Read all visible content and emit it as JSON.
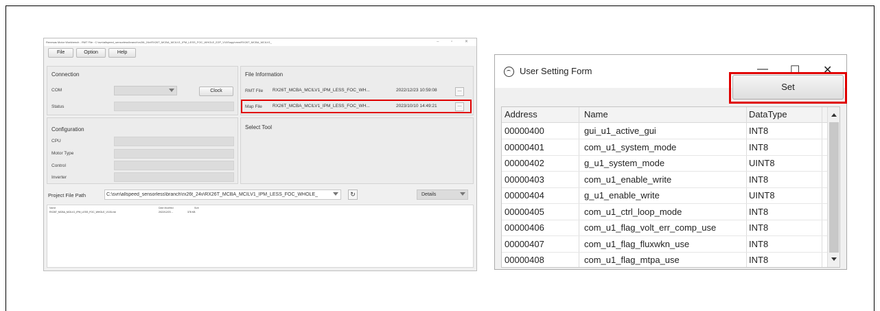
{
  "left_window": {
    "title": "Renesas Motor Workbench  - RMT File : C:\\svn\\allspeed_sensorless\\branch\\rx26t_24v\\RX26T_MCBA_MCILV1_IPM_LESS_FOC_WHOLE_E2P_V100\\app\\rmw\\RX26T_MCBA_MCILV1_",
    "menu": [
      "File",
      "Option",
      "Help"
    ],
    "connection": {
      "title": "Connection",
      "com_label": "COM",
      "clock_button": "Clock",
      "status_label": "Status"
    },
    "file_information": {
      "title": "File Information",
      "rmt_label": "RMT File",
      "rmt_name": "RX26T_MCBA_MCILV1_IPM_LESS_FOC_WH...",
      "rmt_date": "2022/12/23 10:59:08",
      "map_label": "Map File",
      "map_name": "RX26T_MCBA_MCILV1_IPM_LESS_FOC_WH...",
      "map_date": "2023/10/10 14:49:21",
      "browse": "..."
    },
    "configuration": {
      "title": "Configuration",
      "labels": [
        "CPU",
        "Motor Type",
        "Control",
        "Inverter"
      ]
    },
    "select_tool": {
      "title": "Select Tool"
    },
    "project": {
      "label": "Project File Path",
      "path": "C:\\svn\\allspeed_sensorless\\branch\\rx26t_24v\\RX26T_MCBA_MCILV1_IPM_LESS_FOC_WHOLE_",
      "view": "Details",
      "list_headers": [
        "Name",
        "Date Modified",
        "Size"
      ],
      "files": [
        {
          "name": "RX26T_MCBA_MCILV1_IPM_LESS_FOC_WHOLE_V103.rmt",
          "date": "2022/12/23 ...",
          "size": "378 KB"
        }
      ]
    }
  },
  "right_window": {
    "title": "User Setting Form",
    "controls": {
      "minimize": "—",
      "maximize": "☐",
      "close": "✕"
    },
    "set_button": "Set",
    "columns": [
      "Address",
      "Name",
      "DataType"
    ],
    "rows": [
      [
        "00000400",
        "gui_u1_active_gui",
        "INT8"
      ],
      [
        "00000401",
        "com_u1_system_mode",
        "INT8"
      ],
      [
        "00000402",
        "g_u1_system_mode",
        "UINT8"
      ],
      [
        "00000403",
        "com_u1_enable_write",
        "INT8"
      ],
      [
        "00000404",
        "g_u1_enable_write",
        "UINT8"
      ],
      [
        "00000405",
        "com_u1_ctrl_loop_mode",
        "INT8"
      ],
      [
        "00000406",
        "com_u1_flag_volt_err_comp_use",
        "INT8"
      ],
      [
        "00000407",
        "com_u1_flag_fluxwkn_use",
        "INT8"
      ],
      [
        "00000408",
        "com_u1_flag_mtpa_use",
        "INT8"
      ]
    ]
  },
  "colors": {
    "highlight": "#e00000"
  }
}
